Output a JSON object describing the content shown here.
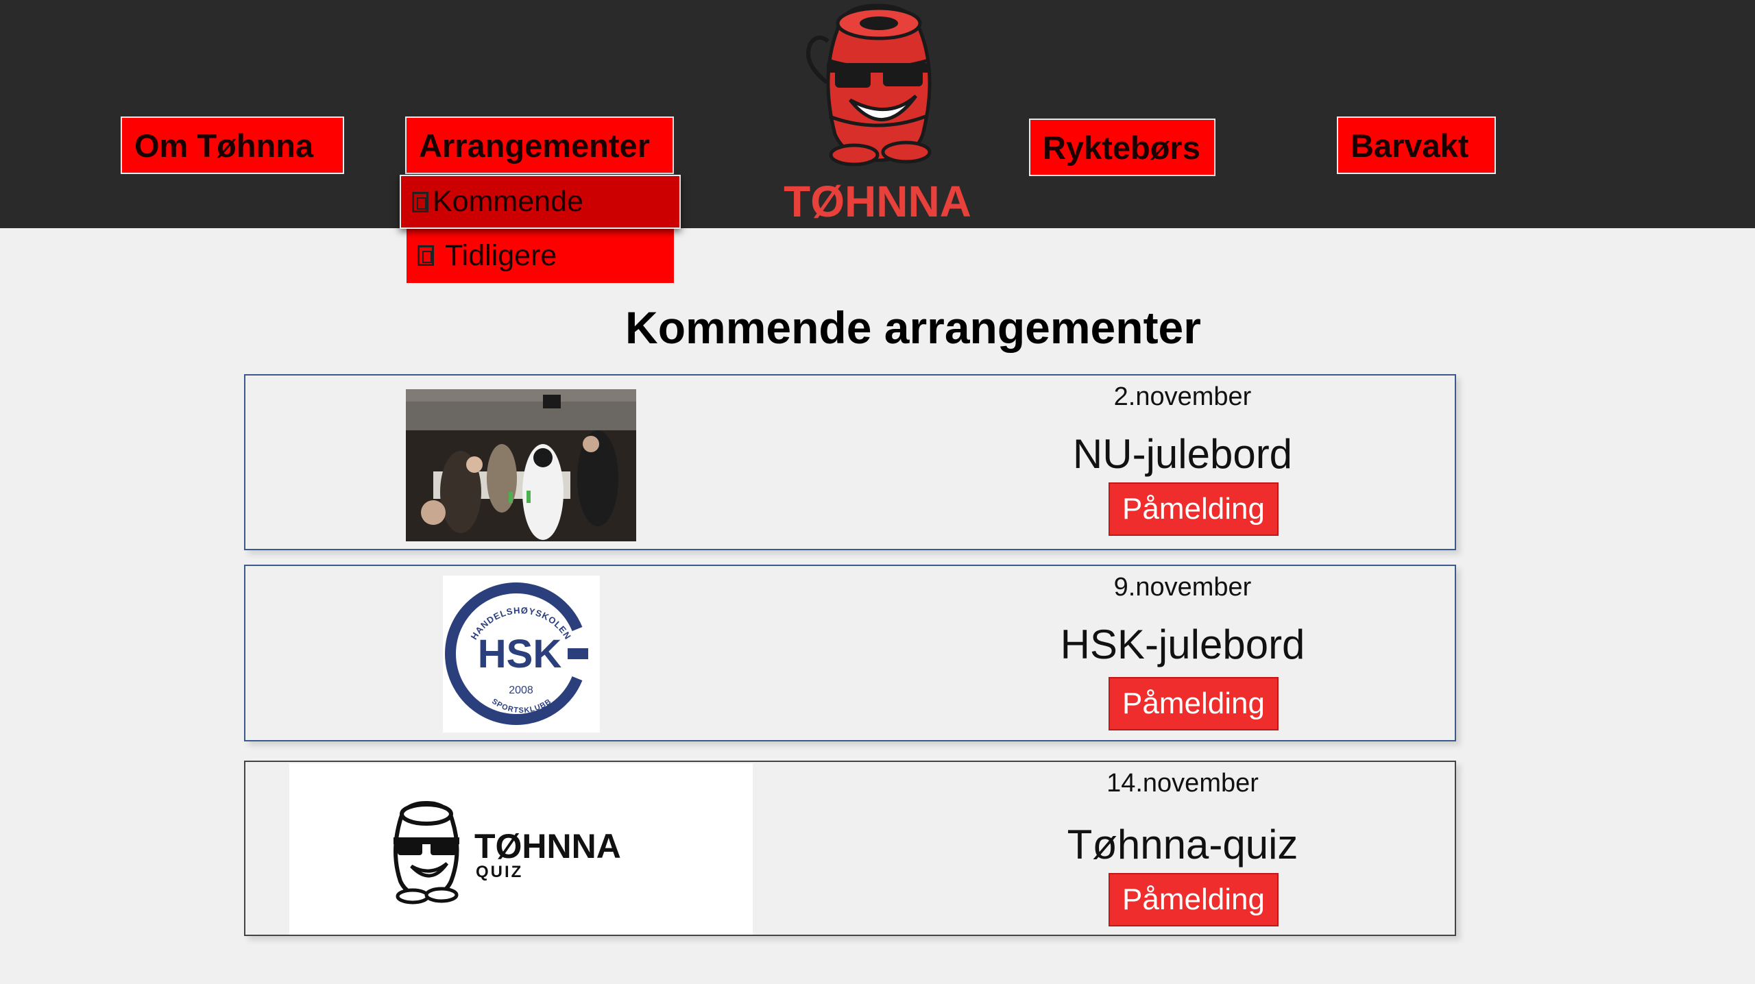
{
  "nav": {
    "om": "Om Tøhnna",
    "arrangementer": "Arrangementer",
    "ryktebors": "Ryktebørs",
    "barvakt": "Barvakt"
  },
  "dropdown": {
    "kommende": "Kommende",
    "tidligere": "Tidligere"
  },
  "logo": {
    "text": "TØHNNA"
  },
  "page_title": "Kommende arrangementer",
  "events": [
    {
      "date": "2.november",
      "name": "NU-julebord",
      "button": "Påmelding"
    },
    {
      "date": "9.november",
      "name": "HSK-julebord",
      "button": "Påmelding"
    },
    {
      "date": "14.november",
      "name": "Tøhnna-quiz",
      "button": "Påmelding"
    }
  ],
  "hsk_logo": {
    "top_text": "HANDELSHØYSKOLEN",
    "initials": "HSK",
    "year": "2008",
    "bottom_text": "SPORTSKLUBB"
  },
  "quiz_logo": {
    "title": "TØHNNA",
    "subtitle": "QUIZ"
  },
  "colors": {
    "header_bg": "#2b2a2a",
    "nav_red": "#ff0000",
    "button_red": "#ef2d2d",
    "page_bg": "#f0f0f0",
    "card_border": "#3a5a8c",
    "hsk_blue": "#2b3f7d"
  }
}
